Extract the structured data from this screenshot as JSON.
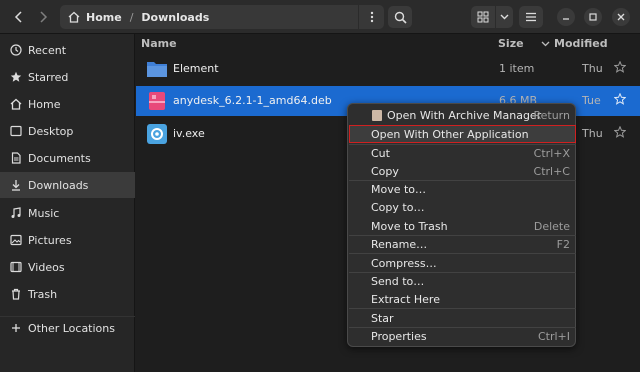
{
  "header": {
    "back_icon": "chevron-left-icon",
    "forward_icon": "chevron-right-icon",
    "path_home": "Home",
    "path_separator": "/",
    "path_current": "Downloads",
    "path_menu_icon": "vertical-dots-icon",
    "search_icon": "search-icon",
    "view_icon": "grid-view-icon",
    "view_dropdown_icon": "chevron-down-icon",
    "menu_icon": "hamburger-icon",
    "minimize_icon": "minimize-icon",
    "maximize_icon": "maximize-icon",
    "close_icon": "close-icon"
  },
  "sidebar": {
    "items": [
      {
        "label": "Recent",
        "icon": "clock-icon"
      },
      {
        "label": "Starred",
        "icon": "star-icon"
      },
      {
        "label": "Home",
        "icon": "home-icon"
      },
      {
        "label": "Desktop",
        "icon": "desktop-icon"
      },
      {
        "label": "Documents",
        "icon": "document-icon"
      },
      {
        "label": "Downloads",
        "icon": "download-icon",
        "active": true
      },
      {
        "label": "Music",
        "icon": "music-icon"
      },
      {
        "label": "Pictures",
        "icon": "picture-icon"
      },
      {
        "label": "Videos",
        "icon": "video-icon"
      },
      {
        "label": "Trash",
        "icon": "trash-icon"
      },
      {
        "label": "Other Locations",
        "icon": "plus-icon"
      }
    ]
  },
  "columns": {
    "name": "Name",
    "size": "Size",
    "modified": "Modified"
  },
  "files": [
    {
      "name": "Element",
      "size": "1 item",
      "modified": "Thu",
      "icon": "folder-icon"
    },
    {
      "name": "anydesk_6.2.1-1_amd64.deb",
      "size": "6.6 MB",
      "modified": "Tue",
      "icon": "package-icon",
      "selected": true
    },
    {
      "name": "iv.exe",
      "size": "",
      "modified": "Thu",
      "icon": "executable-icon"
    }
  ],
  "context_menu": {
    "items": [
      {
        "label": "Open With Archive Manager",
        "accel": "Return",
        "icon": "archive-icon"
      },
      {
        "label": "Open With Other Application",
        "accel": "",
        "highlighted": true
      },
      {
        "label": "Cut",
        "accel": "Ctrl+X"
      },
      {
        "label": "Copy",
        "accel": "Ctrl+C"
      },
      {
        "label": "Move to…",
        "accel": ""
      },
      {
        "label": "Copy to…",
        "accel": ""
      },
      {
        "label": "Move to Trash",
        "accel": "Delete"
      },
      {
        "label": "Rename…",
        "accel": "F2"
      },
      {
        "label": "Compress…",
        "accel": ""
      },
      {
        "label": "Send to…",
        "accel": ""
      },
      {
        "label": "Extract Here",
        "accel": ""
      },
      {
        "label": "Star",
        "accel": ""
      },
      {
        "label": "Properties",
        "accel": "Ctrl+I"
      }
    ]
  },
  "colors": {
    "selection": "#1b6ad0",
    "highlight_outline": "#d02020",
    "background": "#1e1e1e"
  }
}
